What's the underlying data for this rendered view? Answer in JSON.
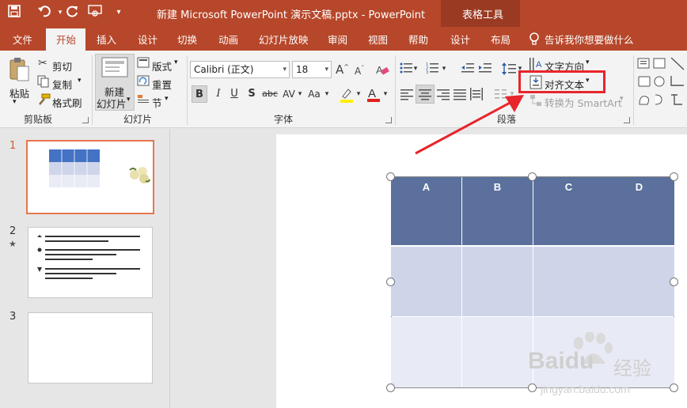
{
  "window": {
    "title": "新建 Microsoft PowerPoint 演示文稿.pptx  -  PowerPoint",
    "context_tool": "表格工具"
  },
  "quick_access": {
    "save": "save-icon",
    "undo": "undo-icon",
    "redo": "redo-icon",
    "present": "present-icon",
    "customize": "▾"
  },
  "tabs": [
    "文件",
    "开始",
    "插入",
    "设计",
    "切换",
    "动画",
    "幻灯片放映",
    "审阅",
    "视图",
    "帮助",
    "设计",
    "布局"
  ],
  "tell_me": "告诉我你想要做什么",
  "ribbon": {
    "clipboard": {
      "paste": "粘贴",
      "cut": "剪切",
      "copy": "复制",
      "format_painter": "格式刷",
      "label": "剪贴板"
    },
    "slides": {
      "new_slide_line1": "新建",
      "new_slide_line2": "幻灯片",
      "layout": "版式",
      "reset": "重置",
      "section": "节",
      "label": "幻灯片"
    },
    "font": {
      "font_name": "Calibri (正文)",
      "font_size": "18",
      "bold": "B",
      "italic": "I",
      "underline": "U",
      "shadow": "S",
      "strike": "abc",
      "spacing": "AV",
      "case": "Aa",
      "label": "字体"
    },
    "paragraph": {
      "text_direction": "文字方向",
      "align_text": "对齐文本",
      "convert_smartart": "转换为 SmartArt",
      "label": "段落"
    }
  },
  "slides_pane": {
    "numbers": [
      "1",
      "2",
      "3"
    ],
    "star": "★"
  },
  "table": {
    "headers": [
      "A",
      "B",
      "C",
      "D"
    ],
    "header_color": "#5b709c",
    "row1_color": "#cfd5e9",
    "row2_color": "#e8ebf5"
  },
  "watermark": {
    "brand": "Bai",
    "brand2": "du",
    "suffix": "经验",
    "url": "jingyan.baidu.com"
  },
  "accent": "#b7472a",
  "highlight_box_color": "#e8252a"
}
